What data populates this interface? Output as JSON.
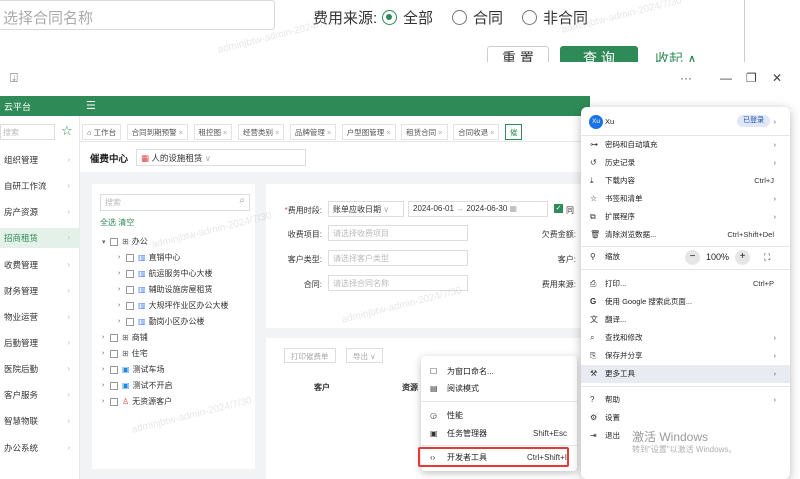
{
  "zoom_strip": {
    "contract_placeholder": "选择合同名称",
    "fee_source_label": "费用来源:",
    "radios": [
      {
        "label": "全部",
        "checked": true
      },
      {
        "label": "合同",
        "checked": false
      },
      {
        "label": "非合同",
        "checked": false
      }
    ],
    "reset_label": "重 置",
    "query_label": "查 询",
    "collapse_label": "收起 ∧",
    "watermark": "adminjbtw-admin-2024/7/30"
  },
  "browser": {
    "download_icon": "download-tray-icon",
    "more_dots": "···",
    "minimize": "—",
    "restore": "❐",
    "close": "✕"
  },
  "app": {
    "title": "云平台",
    "menu_toggle": "☰",
    "brand_color": "#2e8b57"
  },
  "sidebar": {
    "search_placeholder": "搜索",
    "items": [
      {
        "label": "组织管理"
      },
      {
        "label": "自研工作流"
      },
      {
        "label": "房产资源"
      },
      {
        "label": "招商租赁",
        "active": true
      },
      {
        "label": "收费管理"
      },
      {
        "label": "财务管理"
      },
      {
        "label": "物业运营"
      },
      {
        "label": "后勤管理"
      },
      {
        "label": "医院后勤"
      },
      {
        "label": "客户服务"
      },
      {
        "label": "智慧物联"
      },
      {
        "label": "办公系统"
      }
    ]
  },
  "tabs": [
    {
      "label": "⌂ 工作台",
      "closable": false
    },
    {
      "label": "合同到期预警",
      "closable": true
    },
    {
      "label": "租控图",
      "closable": true
    },
    {
      "label": "经营类别",
      "closable": true
    },
    {
      "label": "品牌管理",
      "closable": true
    },
    {
      "label": "户型图管理",
      "closable": true
    },
    {
      "label": "租赁合同",
      "closable": true
    },
    {
      "label": "合同收退",
      "closable": true
    },
    {
      "label": "催",
      "closable": false,
      "active": true
    }
  ],
  "page": {
    "title": "催费中心",
    "scope_label": "人的设施租赁"
  },
  "tree": {
    "search_placeholder": "搜索",
    "select_all": "全选",
    "clear": "清空",
    "nodes": [
      {
        "label": "办公",
        "icon": "group",
        "level": 0,
        "expanded": true
      },
      {
        "label": "直销中心",
        "icon": "building",
        "level": 1
      },
      {
        "label": "航运服务中心大楼",
        "icon": "building",
        "level": 1
      },
      {
        "label": "辅助设施房屋租赁",
        "icon": "building",
        "level": 1
      },
      {
        "label": "大规坪作业区办公大楼",
        "icon": "building",
        "level": 1
      },
      {
        "label": "勤岗小区办公楼",
        "icon": "building",
        "level": 1
      },
      {
        "label": "商铺",
        "icon": "group",
        "level": 0
      },
      {
        "label": "住宅",
        "icon": "group",
        "level": 0
      },
      {
        "label": "测试车场",
        "icon": "car",
        "level": 0
      },
      {
        "label": "测试不开启",
        "icon": "car",
        "level": 0
      },
      {
        "label": "无资源客户",
        "icon": "user",
        "level": 0
      }
    ]
  },
  "form": {
    "fee_period_label": "费用时段:",
    "fee_period_type": "账单应收日期",
    "date_start": "2024-06-01",
    "date_end": "2024-06-30",
    "fee_item_label": "收费项目:",
    "fee_item_placeholder": "请选择收费项目",
    "arrears_label": "欠费金额:",
    "customer_type_label": "客户类型:",
    "customer_type_placeholder": "请选择客户类型",
    "customer_label": "客户:",
    "contract_label": "合同:",
    "contract_placeholder": "请选择合同名称",
    "fee_source_label": "费用来源:",
    "same_label": "同"
  },
  "table": {
    "print_btn": "打印催费单",
    "export_btn": "导出 ∨",
    "col_customer": "客户",
    "col_resource": "资源"
  },
  "submenu": {
    "items": [
      {
        "icon": "window-icon",
        "glyph": "☐",
        "label": "为窗口命名...",
        "shortcut": ""
      },
      {
        "icon": "reading-mode-icon",
        "glyph": "▤",
        "label": "阅读模式",
        "shortcut": ""
      },
      {
        "icon": "performance-icon",
        "glyph": "◶",
        "label": "性能",
        "shortcut": ""
      },
      {
        "icon": "task-manager-icon",
        "glyph": "▣",
        "label": "任务管理器",
        "shortcut": "Shift+Esc"
      },
      {
        "icon": "code-icon",
        "glyph": "‹›",
        "label": "开发者工具",
        "shortcut": "Ctrl+Shift+I"
      }
    ]
  },
  "main_menu": {
    "profile": {
      "avatar": "Xu",
      "name": "Xu",
      "status": "已登录"
    },
    "group1": [
      {
        "icon": "key-icon",
        "glyph": "⊶",
        "label": "密码和自动填充",
        "shortcut": "",
        "submenu": true
      },
      {
        "icon": "history-icon",
        "glyph": "↺",
        "label": "历史记录",
        "shortcut": "",
        "submenu": true
      },
      {
        "icon": "download-icon",
        "glyph": "⤓",
        "label": "下载内容",
        "shortcut": "Ctrl+J",
        "submenu": false
      },
      {
        "icon": "star-icon",
        "glyph": "☆",
        "label": "书签和清单",
        "shortcut": "",
        "submenu": true
      },
      {
        "icon": "extension-icon",
        "glyph": "⧉",
        "label": "扩展程序",
        "shortcut": "",
        "submenu": true
      },
      {
        "icon": "trash-icon",
        "glyph": "🗑",
        "label": "清除浏览数据...",
        "shortcut": "Ctrl+Shift+Del",
        "submenu": false
      }
    ],
    "zoom": {
      "icon": "magnifier-icon",
      "glyph": "⚲",
      "label": "缩放",
      "minus": "−",
      "value": "100%",
      "plus": "+",
      "fullscreen": "⛶"
    },
    "group2": [
      {
        "icon": "print-icon",
        "glyph": "⎙",
        "label": "打印...",
        "shortcut": "Ctrl+P",
        "submenu": false
      },
      {
        "icon": "google-icon",
        "glyph": "G",
        "label": "使用 Google 搜索此页面...",
        "shortcut": "",
        "submenu": false
      },
      {
        "icon": "translate-icon",
        "glyph": "文",
        "label": "翻译...",
        "shortcut": "",
        "submenu": false
      },
      {
        "icon": "find-icon",
        "glyph": "⌕",
        "label": "查找和修改",
        "shortcut": "",
        "submenu": true
      },
      {
        "icon": "save-share-icon",
        "glyph": "⎘",
        "label": "保存并分享",
        "shortcut": "",
        "submenu": true
      },
      {
        "icon": "toolbox-icon",
        "glyph": "⚒",
        "label": "更多工具",
        "shortcut": "",
        "submenu": true,
        "active": true
      }
    ],
    "group3": [
      {
        "icon": "help-icon",
        "glyph": "?",
        "label": "帮助",
        "shortcut": "",
        "submenu": true
      },
      {
        "icon": "settings-icon",
        "glyph": "⚙",
        "label": "设置",
        "shortcut": "",
        "submenu": false
      },
      {
        "icon": "exit-icon",
        "glyph": "⇥",
        "label": "退出",
        "shortcut": "",
        "submenu": false
      }
    ]
  },
  "windows_activation": {
    "line1": "激活 Windows",
    "line2": "转到\"设置\"以激活 Windows。"
  }
}
